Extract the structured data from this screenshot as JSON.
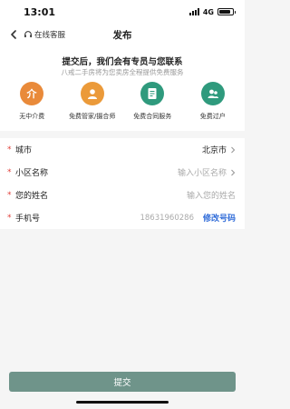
{
  "status_bar": {
    "time": "13:01",
    "network": "4G",
    "battery_level": 0.85
  },
  "nav": {
    "back_icon": "chevron-left-icon",
    "customer_service": "在线客服",
    "title": "发布"
  },
  "intro": {
    "headline": "提交后，我们会有专员与您联系",
    "subline": "八戒二手房将为您卖房全程提供免费服务"
  },
  "features": [
    {
      "label": "无中介费",
      "icon": "no-fee-icon",
      "color": "#e98a3a"
    },
    {
      "label": "免费管家/摄合师",
      "icon": "housekeeper-icon",
      "color": "#eb9a3a"
    },
    {
      "label": "免费合同服务",
      "icon": "contract-icon",
      "color": "#2f9a7d"
    },
    {
      "label": "免费过户",
      "icon": "transfer-icon",
      "color": "#2f9a7d"
    }
  ],
  "form": {
    "required_mark": "*",
    "city": {
      "label": "城市",
      "value": "北京市"
    },
    "community": {
      "label": "小区名称",
      "placeholder": "输入小区名称"
    },
    "name": {
      "label": "您的姓名",
      "placeholder": "输入您的姓名"
    },
    "phone": {
      "label": "手机号",
      "value": "18631960286",
      "edit_label": "修改号码"
    }
  },
  "submit": {
    "label": "提交"
  },
  "colors": {
    "accent": "#2f6bd8",
    "submit_bg": "#6f948a",
    "required": "#e0403a",
    "green": "#2f9a7d",
    "orange": "#e98a3a"
  }
}
